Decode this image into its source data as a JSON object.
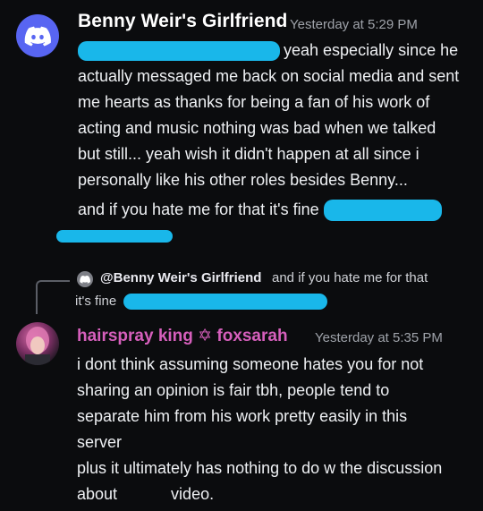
{
  "message1": {
    "author": "Benny Weir's Girlfriend",
    "timestamp": "Yesterday at 5:29 PM",
    "lines": [
      "yeah especially since he",
      "actually messaged me back on social media and sent",
      "me  hearts as thanks for being a fan of his work of",
      "acting and music nothing was bad when we talked",
      "but still... yeah wish it didn't happen at all since i",
      "personally like his other roles besides Benny..."
    ],
    "followup": "and if you hate me for that it's fine"
  },
  "reply_preview": {
    "mention": "@Benny Weir's Girlfriend",
    "text": "and if you hate me for that",
    "text_cont": "it's fine"
  },
  "message2": {
    "author": "hairspray king ✡ foxsarah",
    "timestamp": "Yesterday at 5:35 PM",
    "lines": [
      "i dont think assuming someone hates you for not",
      "sharing an opinion is fair tbh, people tend to",
      "separate him from his work pretty easily in this",
      "server"
    ],
    "followup_lines": [
      "plus it ultimately has nothing to do w the discussion",
      "about            video."
    ]
  },
  "colors": {
    "background": "#0b0c0e",
    "redaction": "#19b7ea",
    "role_pink": "#d65fbc",
    "discord_blurple": "#5865f2"
  },
  "icons": {
    "avatar1": "discord-logo-icon",
    "reply": "discord-small-icon"
  }
}
